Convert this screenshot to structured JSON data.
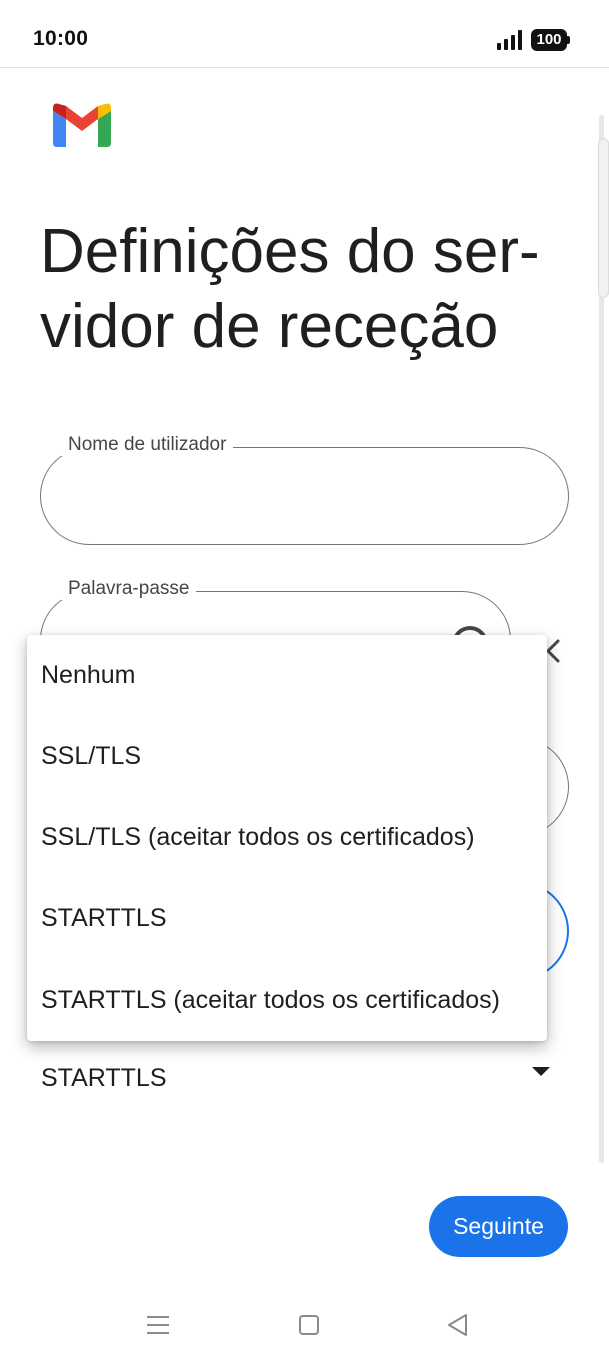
{
  "status_bar": {
    "time": "10:00",
    "battery": "100",
    "icons": [
      "signal-icon",
      "battery-icon"
    ]
  },
  "app": {
    "logo": "gmail-logo",
    "colors": {
      "accent": "#1a73e8",
      "red": "#ea4335",
      "yellow": "#fbbc04",
      "green": "#34a853",
      "blue": "#4285f4"
    }
  },
  "page": {
    "title": "Definições do ser-vidor de receção"
  },
  "form": {
    "username": {
      "label": "Nome de utilizador",
      "value": ""
    },
    "password": {
      "label": "Palavra-passe",
      "value": ""
    },
    "security": {
      "selected": "STARTTLS"
    }
  },
  "dropdown": {
    "options": [
      "Nenhum",
      "SSL/TLS",
      "SSL/TLS (aceitar todos os certificados)",
      "STARTTLS",
      "STARTTLS (aceitar todos os certificados)"
    ]
  },
  "footer": {
    "next_label": "Seguinte"
  },
  "nav_bar": {
    "icons": [
      "menu-icon",
      "home-icon",
      "back-icon"
    ]
  }
}
